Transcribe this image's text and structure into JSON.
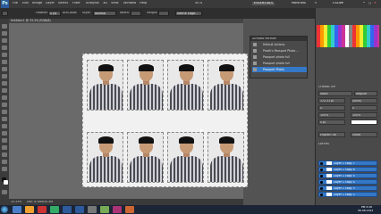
{
  "app": {
    "logo": "Ps"
  },
  "menu": [
    "File",
    "Edit",
    "Image",
    "Layer",
    "Select",
    "Filter",
    "Analysis",
    "3D",
    "View",
    "Window",
    "Help"
  ],
  "zoom": "50.4",
  "workspaces": {
    "essentials": "ESSENTIALS",
    "painting": "PAINTING",
    "arrow": "»",
    "search": "CSLive"
  },
  "options": {
    "feather_label": "Feather:",
    "feather_value": "0 px",
    "antialias": "Anti-alias",
    "style_label": "Style:",
    "style_value": "Normal",
    "width_label": "Width:",
    "height_label": "Height:",
    "refine_edge": "Refine Edge..."
  },
  "document": {
    "tab": "Untitled-1 @ 33.3% (RGB/8)"
  },
  "status": {
    "zoom": "33.33%",
    "doc": "Doc: 8.58M/50.4M"
  },
  "history_panel": {
    "title": "ACTIONS  HISTORY",
    "rows": [
      "Default Actions",
      "Prodh's Passport Photo ...",
      "Passport photo full",
      "Passport photo full",
      "Passport Photo"
    ]
  },
  "character_panel": {
    "title": "CHARACTER",
    "font": "Raavi",
    "style": "Regular",
    "size": "172.31 pt",
    "leading": "(Auto)",
    "kerning": "0",
    "tracking": "0",
    "scale_v": "100%",
    "scale_h": "100%",
    "baseline": "0 pt",
    "lang": "English: UK",
    "aa": "Sharp"
  },
  "layers_panel": {
    "title": "LAYERS",
    "layers": [
      "Layer 1 copy 7",
      "Layer 1 copy 6",
      "Layer 1 copy 5",
      "Layer 1 copy 4",
      "Layer 1 copy 3",
      "Layer 1 copy 2"
    ]
  },
  "taskbar": {
    "time": "PM 6:26",
    "date": "06-08-2012"
  },
  "colors": {
    "selected": "#3478c6",
    "taskbar": "#1b2536",
    "accent": "#2d5a9a"
  }
}
